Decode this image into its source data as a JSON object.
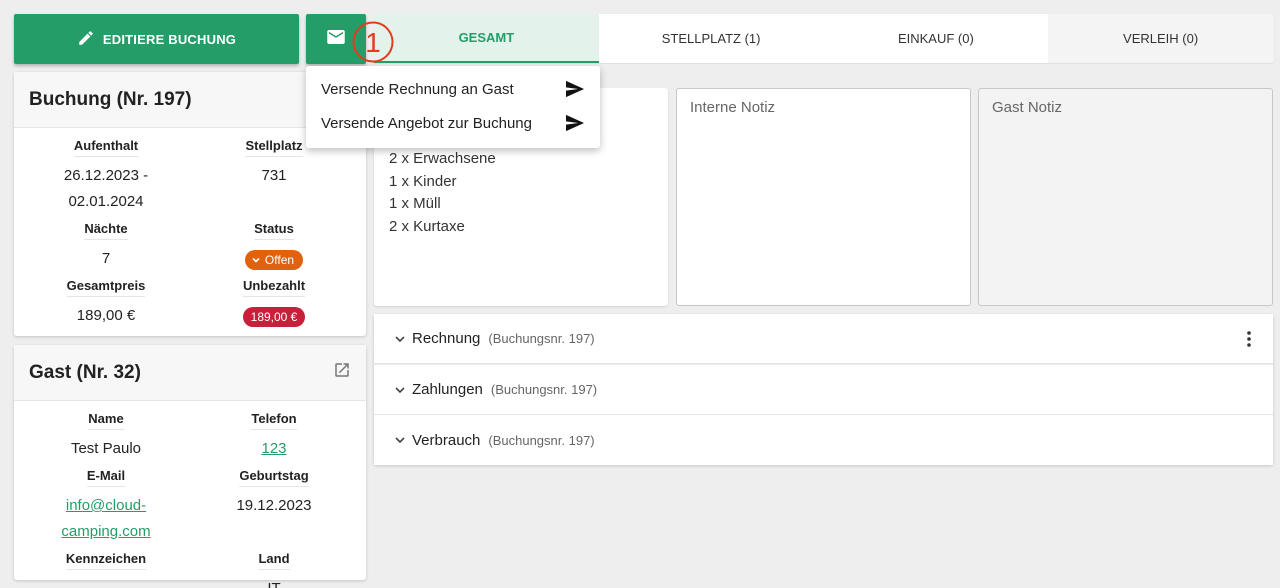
{
  "toolbar": {
    "edit_label": "EDITIERE BUCHUNG",
    "annotation_marker": "1"
  },
  "tabs": [
    {
      "label": "GESAMT",
      "active": true
    },
    {
      "label": "STELLPLATZ (1)",
      "active": false
    },
    {
      "label": "EINKAUF (0)",
      "active": false
    },
    {
      "label": "VERLEIH (0)",
      "active": false
    }
  ],
  "mail_menu": {
    "items": [
      {
        "label": "Versende Rechnung an Gast",
        "icon": "send-icon"
      },
      {
        "label": "Versende Angebot zur Buchung",
        "icon": "send-icon"
      }
    ]
  },
  "booking": {
    "title": "Buchung (Nr. 197)",
    "stay_label": "Aufenthalt",
    "stay_value_1": "26.12.2023 -",
    "stay_value_2": "02.01.2024",
    "pitch_label": "Stellplatz",
    "pitch_value": "731",
    "nights_label": "Nächte",
    "nights_value": "7",
    "status_label": "Status",
    "status_value": "Offen",
    "total_label": "Gesamtpreis",
    "total_value": "189,00 €",
    "unpaid_label": "Unbezahlt",
    "unpaid_value": "189,00 €"
  },
  "guest": {
    "title": "Gast (Nr. 32)",
    "name_label": "Name",
    "name_value": "Test Paulo",
    "phone_label": "Telefon",
    "phone_value": "123",
    "email_label": "E-Mail",
    "email_value": "info@cloud-camping.com",
    "birthday_label": "Geburtstag",
    "birthday_value": "19.12.2023",
    "plate_label": "Kennzeichen",
    "plate_value": "-",
    "country_label": "Land",
    "country_value": "IT"
  },
  "items": [
    "2 x Erwachsene",
    "1 x Kinder",
    "1 x Müll",
    "2 x Kurtaxe"
  ],
  "notes": {
    "internal_placeholder": "Interne Notiz",
    "guest_placeholder": "Gast Notiz"
  },
  "sections": [
    {
      "title": "Rechnung",
      "sub": "(Buchungsnr. 197)"
    },
    {
      "title": "Zahlungen",
      "sub": "(Buchungsnr. 197)"
    },
    {
      "title": "Verbrauch",
      "sub": "(Buchungsnr. 197)"
    }
  ],
  "colors": {
    "primary": "#259d69",
    "status_open": "#e0620e",
    "unpaid": "#c7203a",
    "annotation": "#e53a1e"
  }
}
